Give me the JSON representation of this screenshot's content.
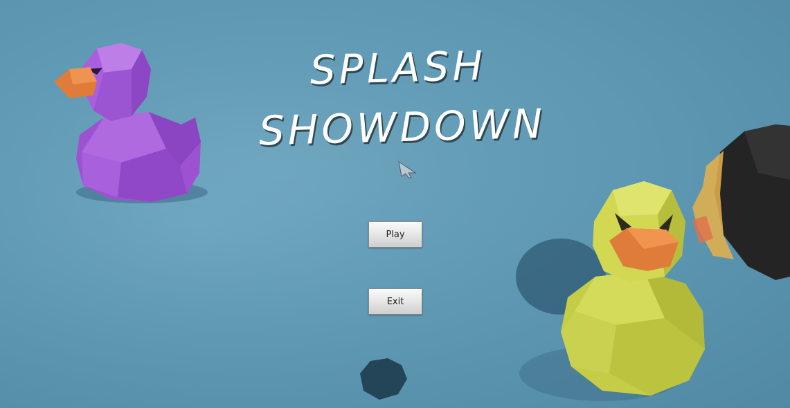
{
  "game": {
    "title_line1": "SPLASH",
    "title_line2": "SHOWDOWN"
  },
  "menu": {
    "play_label": "Play",
    "exit_label": "Exit"
  },
  "colors": {
    "water": "#5f99b4",
    "purple_duck": "#a257d6",
    "yellow_duck": "#c9cf4a",
    "beak": "#e07c3a",
    "title_text": "#ffffff"
  },
  "icons": {
    "cursor": "mouse-pointer-icon"
  }
}
